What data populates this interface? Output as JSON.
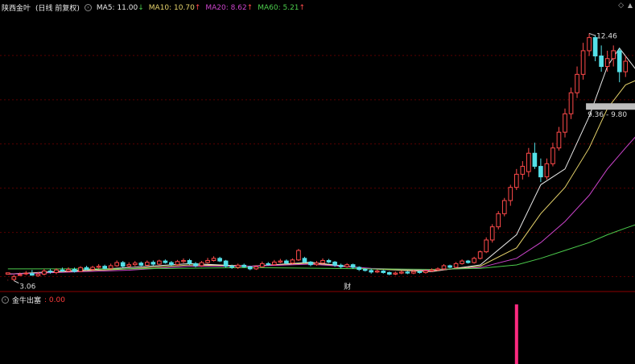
{
  "header": {
    "stock_name": "陕西金叶",
    "period_label": "(日线 前复权)",
    "ma_items": [
      {
        "label": "MA5: 11.00",
        "arrow": "↓",
        "color": "#e8e8e8"
      },
      {
        "label": "MA10: 10.70",
        "arrow": "↑",
        "color": "#e6d36b"
      },
      {
        "label": "MA20: 8.62",
        "arrow": "↑",
        "color": "#cc44cc"
      },
      {
        "label": "MA60: 5.21",
        "arrow": "↑",
        "color": "#4ccc4c"
      }
    ]
  },
  "indicator": {
    "name": "金牛出塞",
    "value": ": 0.00",
    "value_color": "#ff3b3b",
    "signal_color": "#ff2a80"
  },
  "colors": {
    "up": "#ff4a4a",
    "down": "#54e0e8",
    "grid": "#5a0000",
    "highlight_bar": "#bdbdbd"
  },
  "chart_data": {
    "type": "candlestick",
    "y_range": [
      2.7,
      13.3
    ],
    "annotations": {
      "high_label": "12.46",
      "low_label": "3.06",
      "range_box": "9.36 - 9.80",
      "event_marker": "财"
    },
    "candles": [
      [
        3.3,
        3.35,
        3.08,
        3.06
      ],
      [
        3.1,
        3.2,
        3.28,
        3.05
      ],
      [
        3.28,
        3.28,
        3.36,
        3.25
      ],
      [
        3.33,
        3.34,
        3.42,
        3.26
      ],
      [
        3.32,
        3.26,
        3.46,
        3.24
      ],
      [
        3.24,
        3.3,
        3.38,
        3.2
      ],
      [
        3.3,
        3.42,
        3.5,
        3.25
      ],
      [
        3.42,
        3.38,
        3.5,
        3.32
      ],
      [
        3.36,
        3.46,
        3.52,
        3.3
      ],
      [
        3.46,
        3.42,
        3.55,
        3.38
      ],
      [
        3.42,
        3.48,
        3.56,
        3.38
      ],
      [
        3.48,
        3.4,
        3.55,
        3.36
      ],
      [
        3.4,
        3.55,
        3.6,
        3.38
      ],
      [
        3.55,
        3.48,
        3.62,
        3.45
      ],
      [
        3.48,
        3.56,
        3.62,
        3.42
      ],
      [
        3.56,
        3.6,
        3.68,
        3.5
      ],
      [
        3.6,
        3.52,
        3.66,
        3.48
      ],
      [
        3.52,
        3.62,
        3.7,
        3.48
      ],
      [
        3.62,
        3.74,
        3.82,
        3.58
      ],
      [
        3.74,
        3.6,
        3.8,
        3.55
      ],
      [
        3.6,
        3.66,
        3.75,
        3.56
      ],
      [
        3.66,
        3.72,
        3.8,
        3.6
      ],
      [
        3.72,
        3.64,
        3.78,
        3.6
      ],
      [
        3.64,
        3.75,
        3.82,
        3.6
      ],
      [
        3.75,
        3.68,
        3.82,
        3.62
      ],
      [
        3.68,
        3.8,
        3.85,
        3.64
      ],
      [
        3.8,
        3.74,
        3.86,
        3.7
      ],
      [
        3.74,
        3.66,
        3.8,
        3.62
      ],
      [
        3.66,
        3.78,
        3.84,
        3.62
      ],
      [
        3.78,
        3.82,
        3.9,
        3.72
      ],
      [
        3.82,
        3.7,
        3.88,
        3.66
      ],
      [
        3.7,
        3.62,
        3.76,
        3.56
      ],
      [
        3.62,
        3.74,
        3.8,
        3.58
      ],
      [
        3.74,
        3.82,
        3.92,
        3.7
      ],
      [
        3.82,
        3.9,
        3.98,
        3.78
      ],
      [
        3.9,
        3.8,
        3.96,
        3.76
      ],
      [
        3.8,
        3.6,
        3.84,
        3.55
      ],
      [
        3.6,
        3.56,
        3.66,
        3.5
      ],
      [
        3.56,
        3.64,
        3.7,
        3.5
      ],
      [
        3.64,
        3.58,
        3.7,
        3.54
      ],
      [
        3.58,
        3.5,
        3.62,
        3.45
      ],
      [
        3.5,
        3.58,
        3.64,
        3.46
      ],
      [
        3.58,
        3.7,
        3.78,
        3.55
      ],
      [
        3.7,
        3.66,
        3.76,
        3.62
      ],
      [
        3.66,
        3.76,
        3.84,
        3.62
      ],
      [
        3.76,
        3.8,
        3.88,
        3.72
      ],
      [
        3.8,
        3.72,
        3.86,
        3.68
      ],
      [
        3.72,
        3.84,
        3.9,
        3.68
      ],
      [
        3.84,
        4.2,
        4.26,
        3.8
      ],
      [
        3.9,
        3.76,
        3.96,
        3.72
      ],
      [
        3.76,
        3.66,
        3.8,
        3.6
      ],
      [
        3.66,
        3.72,
        3.8,
        3.62
      ],
      [
        3.72,
        3.82,
        3.9,
        3.7
      ],
      [
        3.82,
        3.76,
        3.88,
        3.72
      ],
      [
        3.76,
        3.64,
        3.8,
        3.58
      ],
      [
        3.64,
        3.58,
        3.7,
        3.52
      ],
      [
        3.58,
        3.66,
        3.72,
        3.54
      ],
      [
        3.66,
        3.56,
        3.7,
        3.5
      ],
      [
        3.56,
        3.48,
        3.6,
        3.42
      ],
      [
        3.48,
        3.44,
        3.52,
        3.4
      ],
      [
        3.44,
        3.38,
        3.5,
        3.32
      ],
      [
        3.38,
        3.42,
        3.48,
        3.34
      ],
      [
        3.42,
        3.36,
        3.46,
        3.32
      ],
      [
        3.36,
        3.3,
        3.4,
        3.26
      ],
      [
        3.3,
        3.34,
        3.4,
        3.26
      ],
      [
        3.34,
        3.38,
        3.44,
        3.3
      ],
      [
        3.38,
        3.34,
        3.42,
        3.3
      ],
      [
        3.34,
        3.4,
        3.46,
        3.3
      ],
      [
        3.4,
        3.36,
        3.44,
        3.32
      ],
      [
        3.36,
        3.42,
        3.48,
        3.32
      ],
      [
        3.42,
        3.46,
        3.52,
        3.38
      ],
      [
        3.46,
        3.5,
        3.56,
        3.42
      ],
      [
        3.5,
        3.62,
        3.68,
        3.46
      ],
      [
        3.62,
        3.56,
        3.66,
        3.52
      ],
      [
        3.56,
        3.7,
        3.76,
        3.52
      ],
      [
        3.7,
        3.8,
        3.86,
        3.66
      ],
      [
        3.8,
        3.74,
        3.84,
        3.7
      ],
      [
        3.74,
        3.9,
        3.96,
        3.7
      ],
      [
        3.9,
        4.15,
        4.2,
        3.86
      ],
      [
        4.15,
        4.6,
        4.7,
        4.1
      ],
      [
        4.6,
        5.1,
        5.2,
        4.5
      ],
      [
        5.1,
        5.6,
        5.7,
        5.0
      ],
      [
        5.6,
        6.1,
        6.2,
        5.5
      ],
      [
        6.1,
        6.6,
        6.7,
        5.9
      ],
      [
        6.6,
        7.1,
        7.3,
        6.5
      ],
      [
        7.1,
        7.4,
        7.6,
        6.9
      ],
      [
        7.2,
        7.9,
        8.1,
        7.0
      ],
      [
        7.9,
        7.4,
        8.3,
        7.3
      ],
      [
        7.4,
        7.0,
        7.7,
        6.8
      ],
      [
        7.0,
        7.5,
        7.7,
        6.9
      ],
      [
        7.5,
        8.1,
        8.3,
        7.4
      ],
      [
        8.1,
        8.7,
        8.9,
        8.0
      ],
      [
        8.7,
        9.4,
        9.6,
        8.5
      ],
      [
        9.4,
        10.2,
        10.4,
        9.2
      ],
      [
        10.2,
        10.9,
        11.2,
        10.0
      ],
      [
        10.9,
        11.8,
        12.1,
        10.7
      ],
      [
        11.8,
        12.3,
        12.46,
        11.6
      ],
      [
        12.3,
        11.6,
        12.4,
        11.4
      ],
      [
        11.6,
        11.2,
        12.0,
        11.0
      ],
      [
        11.2,
        11.5,
        11.8,
        11.0
      ],
      [
        11.5,
        11.8,
        12.0,
        11.2
      ],
      [
        11.8,
        11.0,
        11.9,
        10.6
      ],
      [
        11.0,
        11.4,
        11.6,
        10.8
      ]
    ],
    "ma_series": [
      {
        "name": "MA5",
        "color": "#e8e8e8",
        "points": [
          [
            0,
            3.3
          ],
          [
            20,
            3.55
          ],
          [
            30,
            3.7
          ],
          [
            40,
            3.6
          ],
          [
            50,
            3.75
          ],
          [
            60,
            3.5
          ],
          [
            70,
            3.4
          ],
          [
            78,
            3.65
          ],
          [
            84,
            4.8
          ],
          [
            88,
            6.7
          ],
          [
            92,
            7.3
          ],
          [
            96,
            9.3
          ],
          [
            99,
            11.2
          ],
          [
            101,
            11.9
          ],
          [
            104,
            11.0
          ]
        ]
      },
      {
        "name": "MA10",
        "color": "#e6d36b",
        "points": [
          [
            0,
            3.3
          ],
          [
            20,
            3.5
          ],
          [
            30,
            3.65
          ],
          [
            40,
            3.6
          ],
          [
            50,
            3.72
          ],
          [
            60,
            3.5
          ],
          [
            70,
            3.42
          ],
          [
            78,
            3.6
          ],
          [
            84,
            4.3
          ],
          [
            88,
            5.6
          ],
          [
            92,
            6.6
          ],
          [
            96,
            8.1
          ],
          [
            99,
            9.6
          ],
          [
            102,
            10.5
          ],
          [
            104,
            10.7
          ]
        ]
      },
      {
        "name": "MA20",
        "color": "#cc44cc",
        "points": [
          [
            0,
            3.3
          ],
          [
            20,
            3.45
          ],
          [
            30,
            3.6
          ],
          [
            40,
            3.6
          ],
          [
            50,
            3.68
          ],
          [
            60,
            3.52
          ],
          [
            70,
            3.45
          ],
          [
            78,
            3.55
          ],
          [
            84,
            3.9
          ],
          [
            88,
            4.5
          ],
          [
            92,
            5.3
          ],
          [
            96,
            6.3
          ],
          [
            99,
            7.3
          ],
          [
            102,
            8.1
          ],
          [
            104,
            8.62
          ]
        ]
      },
      {
        "name": "MA60",
        "color": "#4ccc4c",
        "points": [
          [
            0,
            3.5
          ],
          [
            20,
            3.5
          ],
          [
            40,
            3.55
          ],
          [
            60,
            3.5
          ],
          [
            70,
            3.48
          ],
          [
            78,
            3.52
          ],
          [
            84,
            3.65
          ],
          [
            88,
            3.9
          ],
          [
            92,
            4.2
          ],
          [
            96,
            4.5
          ],
          [
            99,
            4.8
          ],
          [
            102,
            5.05
          ],
          [
            104,
            5.21
          ]
        ]
      }
    ],
    "signal": {
      "index": 84,
      "value": 1
    }
  }
}
